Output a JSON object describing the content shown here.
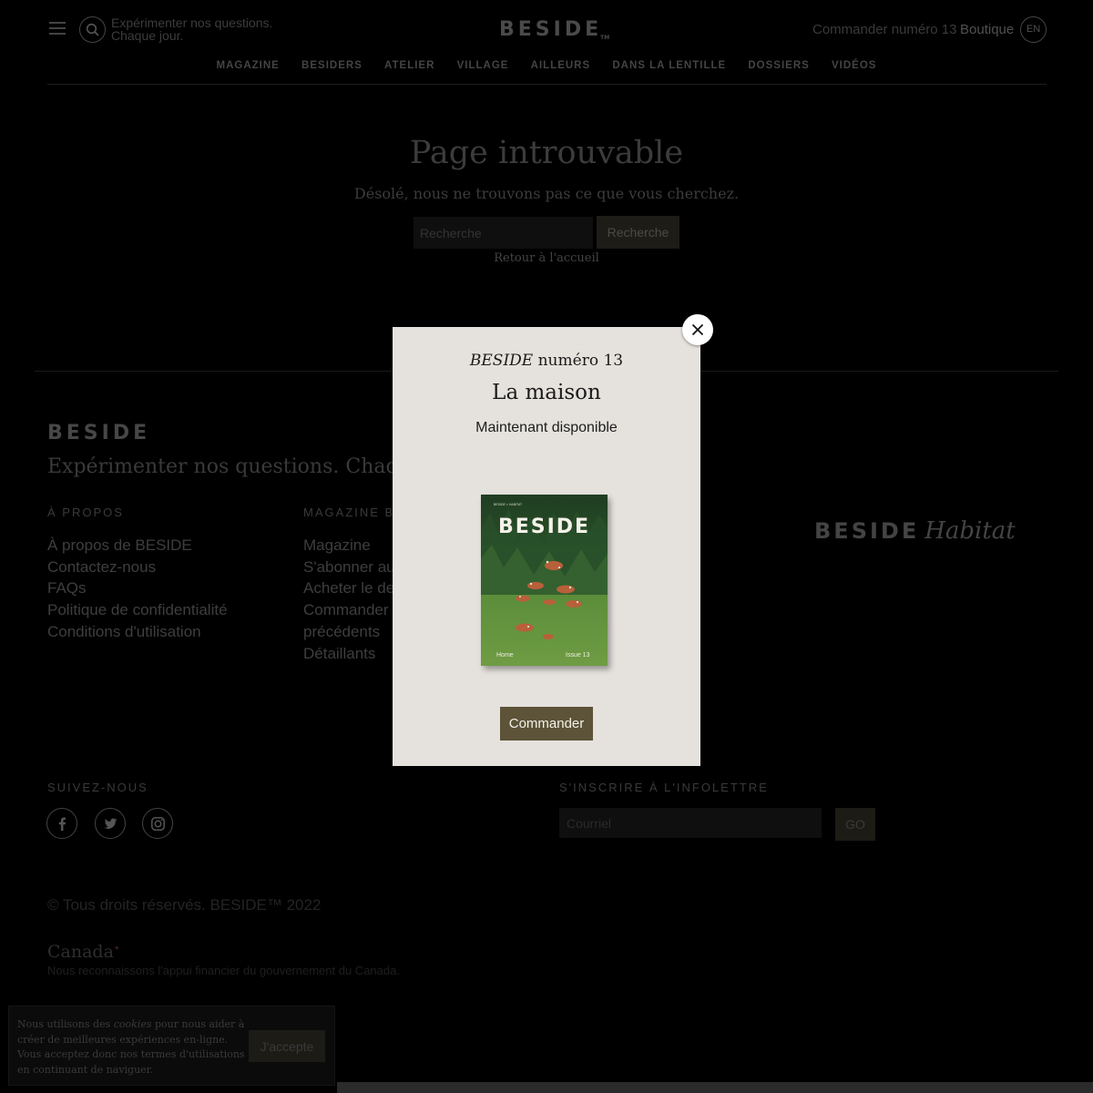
{
  "header": {
    "tagline_line1": "Expérimenter nos questions.",
    "tagline_line2": "Chaque jour.",
    "logo": "BESIDE",
    "logo_mark": "TM",
    "order_link": "Commander numéro 13",
    "shop_link": "Boutique",
    "lang": "EN",
    "menu_icon": "hamburger-icon",
    "search_icon": "search-icon"
  },
  "nav": {
    "items": [
      "MAGAZINE",
      "BESIDERS",
      "ATELIER",
      "VILLAGE",
      "AILLEURS",
      "DANS LA LENTILLE",
      "DOSSIERS",
      "VIDÉOS"
    ]
  },
  "error": {
    "title": "Page introuvable",
    "subtitle": "Désolé, nous ne trouvons pas ce que vous cherchez.",
    "search_placeholder": "Recherche",
    "search_button": "Recherche",
    "home_link": "Retour à l'accueil"
  },
  "footer": {
    "logo": "BESIDE",
    "tagline": "Expérimenter nos questions. Chaque jour.",
    "about": {
      "heading": "À PROPOS",
      "links": [
        "À propos de BESIDE",
        "Contactez-nous",
        "FAQs",
        "Politique de confidentialité",
        "Conditions d'utilisation"
      ]
    },
    "magazine": {
      "heading": "MAGAZINE BESIDE",
      "links": [
        "Magazine",
        "S'abonner au magazine",
        "Acheter le dernier numéro",
        "Commander les numéros",
        "précédents",
        "Détaillants"
      ]
    },
    "habitat_word1": "BESIDE",
    "habitat_word2": "Habitat",
    "follow_heading": "SUIVEZ-NOUS",
    "social_icons": [
      "facebook-icon",
      "twitter-icon",
      "instagram-icon"
    ],
    "newsletter_heading": "S'INSCRIRE À L'INFOLETTRE",
    "email_placeholder": "Courriel",
    "go_button": "GO",
    "copyright": "© Tous droits réservés. BESIDE™ 2022",
    "canada_wordmark": "Canada",
    "canada_note": "Nous reconnaissons l'appui financier du gouvernement du Canada."
  },
  "cookie": {
    "text_before": "Nous utilisons des ",
    "text_italic": "cookies",
    "text_after": " pour nous aider à créer de meilleures expériences en-ligne. Vous acceptez donc nos termes d'utilisations en continuant de naviguer.",
    "button": "J'accepte"
  },
  "modal": {
    "issue_brand": "BESIDE",
    "issue_number": "numéro 13",
    "title": "La maison",
    "availability": "Maintenant disponible",
    "cover_logo": "BESIDE",
    "cover_top_text": "BESIDE × HABITAT",
    "cover_left": "Home",
    "cover_right": "Issue 13",
    "order_button": "Commander",
    "close_icon": "close-icon"
  },
  "colors": {
    "backdrop": "#000000",
    "modal_bg": "#e5e2dd",
    "order_button": "#5c5338",
    "cover_green": "#3e6b2f"
  }
}
